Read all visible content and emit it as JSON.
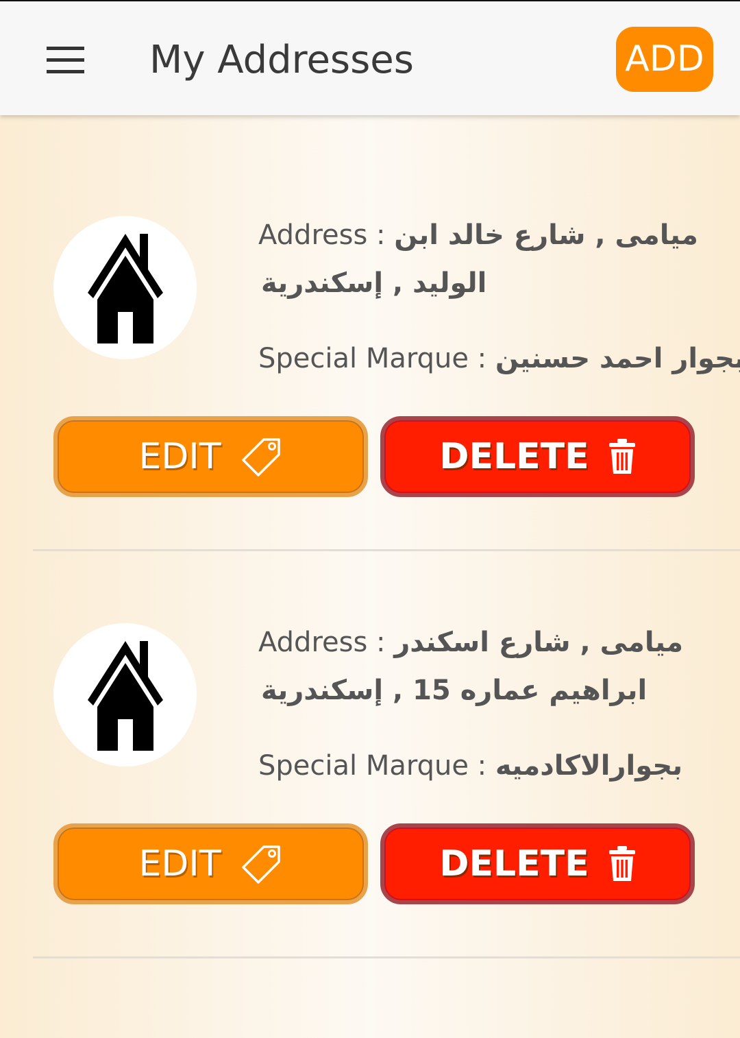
{
  "appbar": {
    "title": "My Addresses",
    "add_label": "ADD",
    "menu_icon": "hamburger-menu-icon"
  },
  "colors": {
    "accent": "#ff8c00",
    "danger": "#ff1e00"
  },
  "addresses": [
    {
      "address_label": "Address : ",
      "address_line1": "ميامى , شارع خالد ابن",
      "address_line2": "الوليد , إسكندرية",
      "mark_label": "Special Marque : ",
      "mark_value": "بجوار احمد حسنين",
      "edit_label": "EDIT",
      "delete_label": "DELETE"
    },
    {
      "address_label": "Address : ",
      "address_line1": "ميامى , شارع اسكندر",
      "address_line2": "ابراهيم عماره 15 , إسكندرية",
      "mark_label": "Special Marque : ",
      "mark_value": "بجوارالاكادميه",
      "edit_label": "EDIT",
      "delete_label": "DELETE"
    }
  ]
}
